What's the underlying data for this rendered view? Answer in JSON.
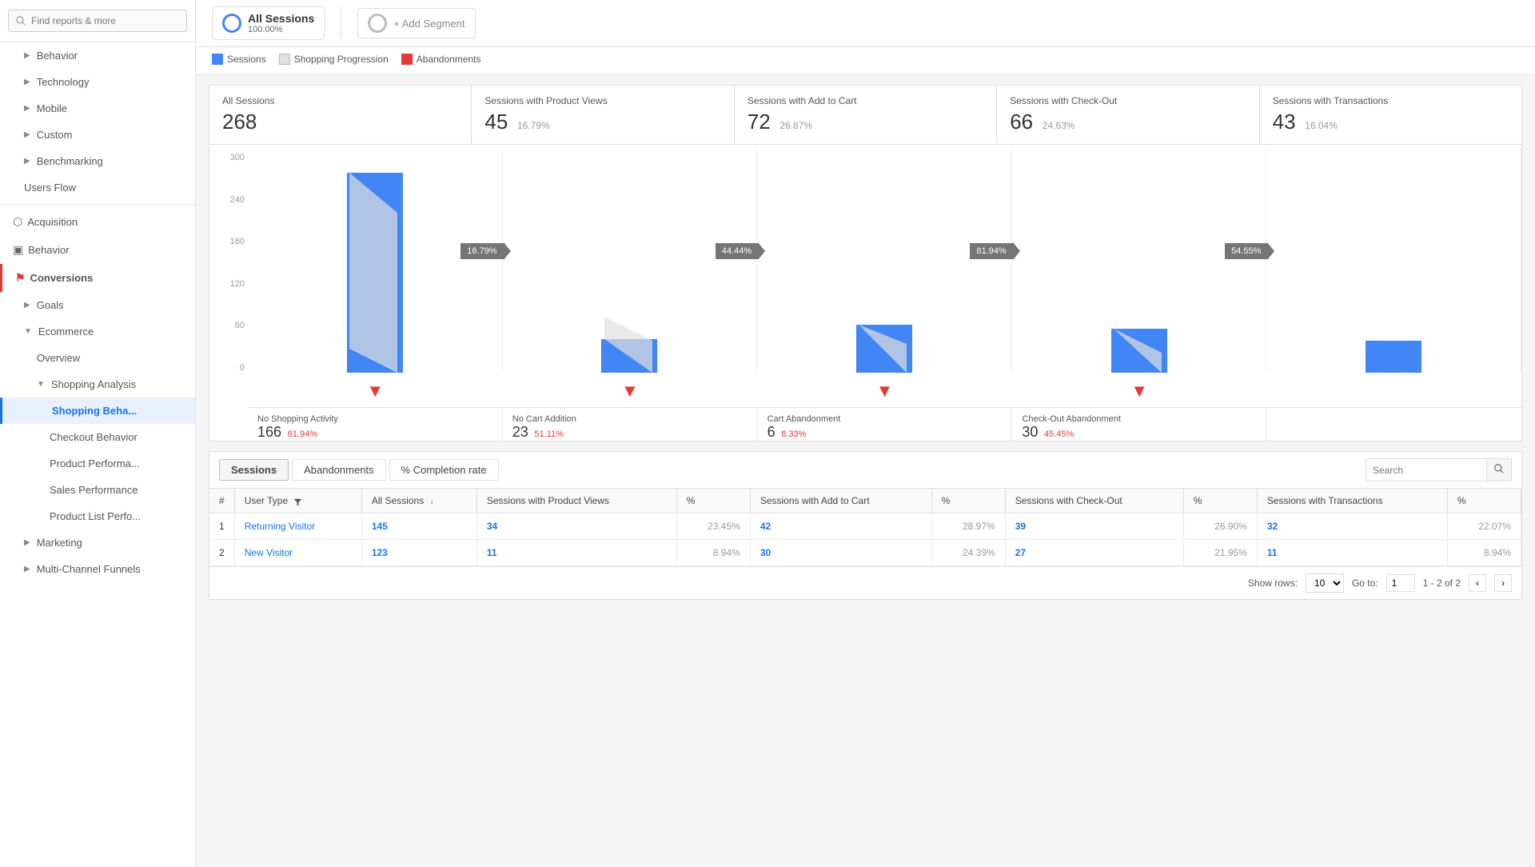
{
  "sidebar": {
    "search_placeholder": "Find reports & more",
    "items": [
      {
        "label": "Behavior",
        "type": "collapse",
        "level": 1
      },
      {
        "label": "Technology",
        "type": "collapse",
        "level": 1
      },
      {
        "label": "Mobile",
        "type": "collapse",
        "level": 1
      },
      {
        "label": "Custom",
        "type": "collapse",
        "level": 1
      },
      {
        "label": "Benchmarking",
        "type": "collapse",
        "level": 1
      },
      {
        "label": "Users Flow",
        "type": "link",
        "level": 1
      },
      {
        "label": "Acquisition",
        "type": "section",
        "icon": "acquisition"
      },
      {
        "label": "Behavior",
        "type": "section",
        "icon": "behavior"
      },
      {
        "label": "Conversions",
        "type": "section-active",
        "icon": "flag"
      },
      {
        "label": "Goals",
        "type": "collapse",
        "level": 2
      },
      {
        "label": "Ecommerce",
        "type": "expand",
        "level": 2
      },
      {
        "label": "Overview",
        "type": "link",
        "level": 3
      },
      {
        "label": "Shopping Analysis",
        "type": "expand",
        "level": 3
      },
      {
        "label": "Shopping Beha...",
        "type": "active-link",
        "level": 4
      },
      {
        "label": "Checkout Behavior",
        "type": "link",
        "level": 4
      },
      {
        "label": "Product Performa...",
        "type": "link",
        "level": 4
      },
      {
        "label": "Sales Performance",
        "type": "link",
        "level": 4
      },
      {
        "label": "Product List Perfo...",
        "type": "link",
        "level": 4
      },
      {
        "label": "Marketing",
        "type": "collapse",
        "level": 2
      },
      {
        "label": "Multi-Channel Funnels",
        "type": "collapse",
        "level": 2
      }
    ]
  },
  "segments": {
    "segment1": {
      "title": "All Sessions",
      "pct": "100.00%"
    },
    "segment2": {
      "label": "+ Add Segment"
    }
  },
  "legend": {
    "items": [
      {
        "label": "Sessions",
        "color": "blue"
      },
      {
        "label": "Shopping Progression",
        "color": "gray"
      },
      {
        "label": "Abandonments",
        "color": "red"
      }
    ]
  },
  "funnel_metrics": [
    {
      "title": "All Sessions",
      "value": "268",
      "pct": ""
    },
    {
      "title": "Sessions with Product Views",
      "value": "45",
      "pct": "16.79%"
    },
    {
      "title": "Sessions with Add to Cart",
      "value": "72",
      "pct": "26.87%"
    },
    {
      "title": "Sessions with Check-Out",
      "value": "66",
      "pct": "24.63%"
    },
    {
      "title": "Sessions with Transactions",
      "value": "43",
      "pct": "16.04%"
    }
  ],
  "y_axis": [
    "300",
    "240",
    "180",
    "120",
    "60",
    "0"
  ],
  "bars": [
    {
      "height_pct": 89,
      "value": 268
    },
    {
      "height_pct": 33,
      "value": 45
    },
    {
      "height_pct": 27,
      "value": 72
    },
    {
      "height_pct": 25,
      "value": 66
    },
    {
      "height_pct": 16,
      "value": 43
    }
  ],
  "arrows": [
    "16.79%",
    "44.44%",
    "81.94%",
    "54.55%"
  ],
  "abandonments": [
    {
      "title": "No Shopping Activity",
      "value": "166",
      "pct": "61.94%"
    },
    {
      "title": "No Cart Addition",
      "value": "23",
      "pct": "51.11%"
    },
    {
      "title": "Cart Abandonment",
      "value": "6",
      "pct": "8.33%"
    },
    {
      "title": "Check-Out Abandonment",
      "value": "30",
      "pct": "45.45%"
    }
  ],
  "table": {
    "tabs": [
      "Sessions",
      "Abandonments",
      "% Completion rate"
    ],
    "search_placeholder": "Search",
    "active_tab": "Sessions",
    "columns": [
      {
        "label": "User Type",
        "filter": true,
        "sort": true
      },
      {
        "label": "All Sessions",
        "sort": true
      },
      {
        "label": "Sessions with Product Views",
        "sort": false
      },
      {
        "label": "%",
        "sort": false
      },
      {
        "label": "Sessions with Add to Cart",
        "sort": false
      },
      {
        "label": "%",
        "sort": false
      },
      {
        "label": "Sessions with Check-Out",
        "sort": false
      },
      {
        "label": "%",
        "sort": false
      },
      {
        "label": "Sessions with Transactions",
        "sort": false
      },
      {
        "label": "%",
        "sort": false
      }
    ],
    "rows": [
      {
        "num": 1,
        "type": "Returning Visitor",
        "all": "145",
        "product_views": "34",
        "pv_pct": "23.45%",
        "add_cart": "42",
        "ac_pct": "28.97%",
        "checkout": "39",
        "co_pct": "26.90%",
        "transactions": "32",
        "t_pct": "22.07%"
      },
      {
        "num": 2,
        "type": "New Visitor",
        "all": "123",
        "product_views": "11",
        "pv_pct": "8.94%",
        "add_cart": "30",
        "ac_pct": "24.39%",
        "checkout": "27",
        "co_pct": "21.95%",
        "transactions": "11",
        "t_pct": "8.94%"
      }
    ],
    "footer": {
      "show_rows_label": "Show rows:",
      "rows_value": "10",
      "goto_label": "Go to:",
      "goto_value": "1",
      "page_info": "1 - 2 of 2"
    }
  }
}
